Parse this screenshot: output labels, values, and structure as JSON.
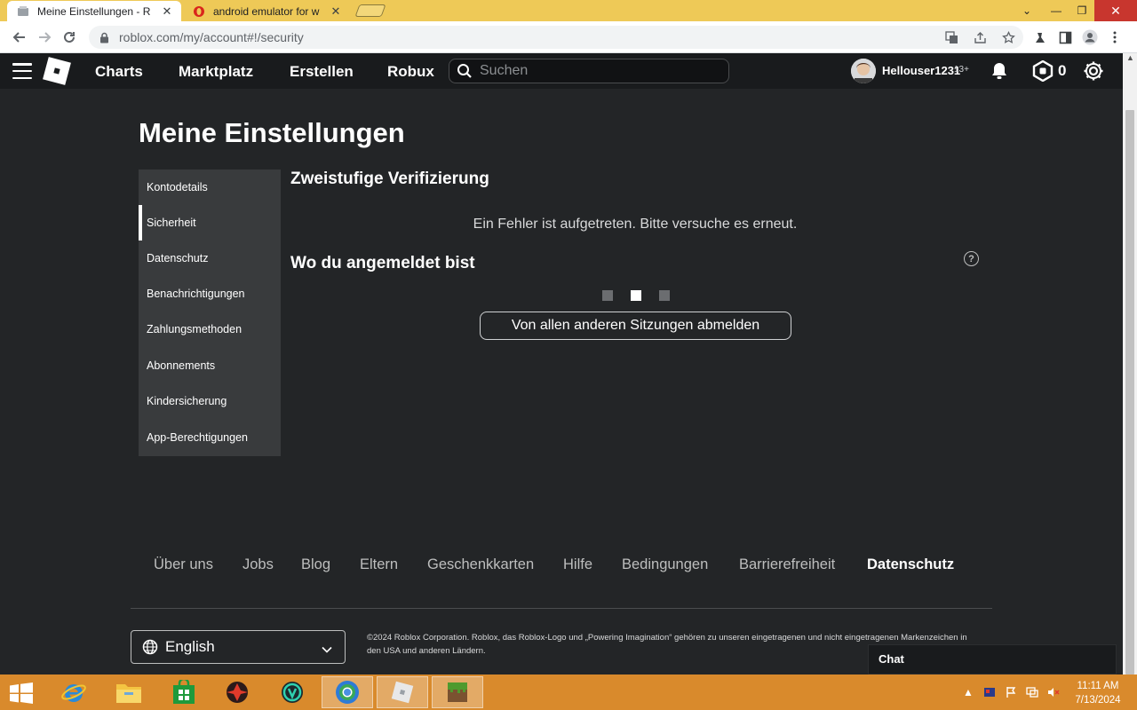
{
  "browser": {
    "tabs": [
      {
        "title": "Meine Einstellungen - R",
        "active": true
      },
      {
        "title": "android emulator for w",
        "active": false
      }
    ],
    "close_glyph": "✕",
    "url": "roblox.com/my/account#!/security",
    "window_controls": {
      "chevron": "⌄",
      "minimize": "—",
      "maximize": "❐",
      "close": "✕"
    }
  },
  "header": {
    "nav": [
      "Charts",
      "Marktplatz",
      "Erstellen",
      "Robux"
    ],
    "search_placeholder": "Suchen",
    "username": "Hellouser1231",
    "age_badge": "13+",
    "robux_balance": "0"
  },
  "page": {
    "title": "Meine Einstellungen",
    "sidebar": [
      {
        "label": "Kontodetails",
        "active": false
      },
      {
        "label": "Sicherheit",
        "active": true
      },
      {
        "label": "Datenschutz",
        "active": false
      },
      {
        "label": "Benachrichtigungen",
        "active": false
      },
      {
        "label": "Zahlungsmethoden",
        "active": false
      },
      {
        "label": "Abonnements",
        "active": false
      },
      {
        "label": "Kindersicherung",
        "active": false
      },
      {
        "label": "App-Berechtigungen",
        "active": false
      }
    ],
    "two_step": {
      "title": "Zweistufige Verifizierung",
      "error": "Ein Fehler ist aufgetreten. Bitte versuche es erneut."
    },
    "sessions": {
      "title": "Wo du angemeldet bist",
      "help_glyph": "?",
      "logout_button": "Von allen anderen Sitzungen abmelden"
    }
  },
  "footer": {
    "links": [
      "Über uns",
      "Jobs",
      "Blog",
      "Eltern",
      "Geschenkkarten",
      "Hilfe",
      "Bedingungen",
      "Barrierefreiheit",
      "Datenschutz"
    ],
    "language": "English",
    "copyright": "©2024 Roblox Corporation. Roblox, das Roblox-Logo und „Powering Imagination“ gehören zu unseren eingetragenen und nicht eingetragenen Markenzeichen in den USA und anderen Ländern."
  },
  "chat": {
    "label": "Chat"
  },
  "taskbar": {
    "time": "11:11 AM",
    "date": "7/13/2024",
    "tray_arrow": "▲"
  },
  "colors": {
    "page_bg": "#232527",
    "header_bg": "#191b1d",
    "sidebar_bg": "#393b3d",
    "tabstrip": "#eec957",
    "taskbar": "#d98a2c"
  }
}
